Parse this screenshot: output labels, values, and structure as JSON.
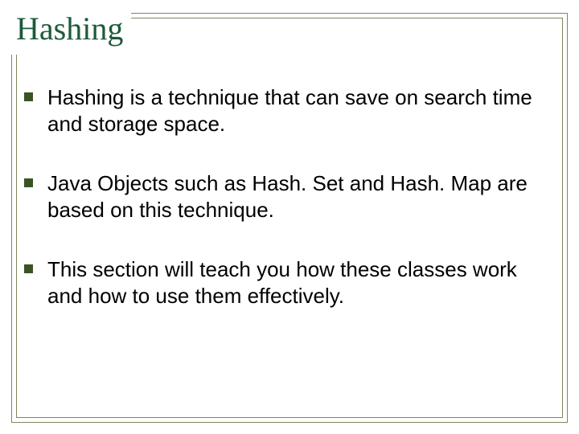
{
  "slide": {
    "title": "Hashing",
    "bullets": [
      "Hashing is a technique that can save on search time and storage space.",
      "Java Objects such as Hash. Set and Hash. Map are based on this technique.",
      "This section will teach you how these classes work and how to use them effectively."
    ]
  },
  "colors": {
    "title": "#1e5a3a",
    "frame": "#7a8a5a",
    "bullet": "#3a5323"
  }
}
